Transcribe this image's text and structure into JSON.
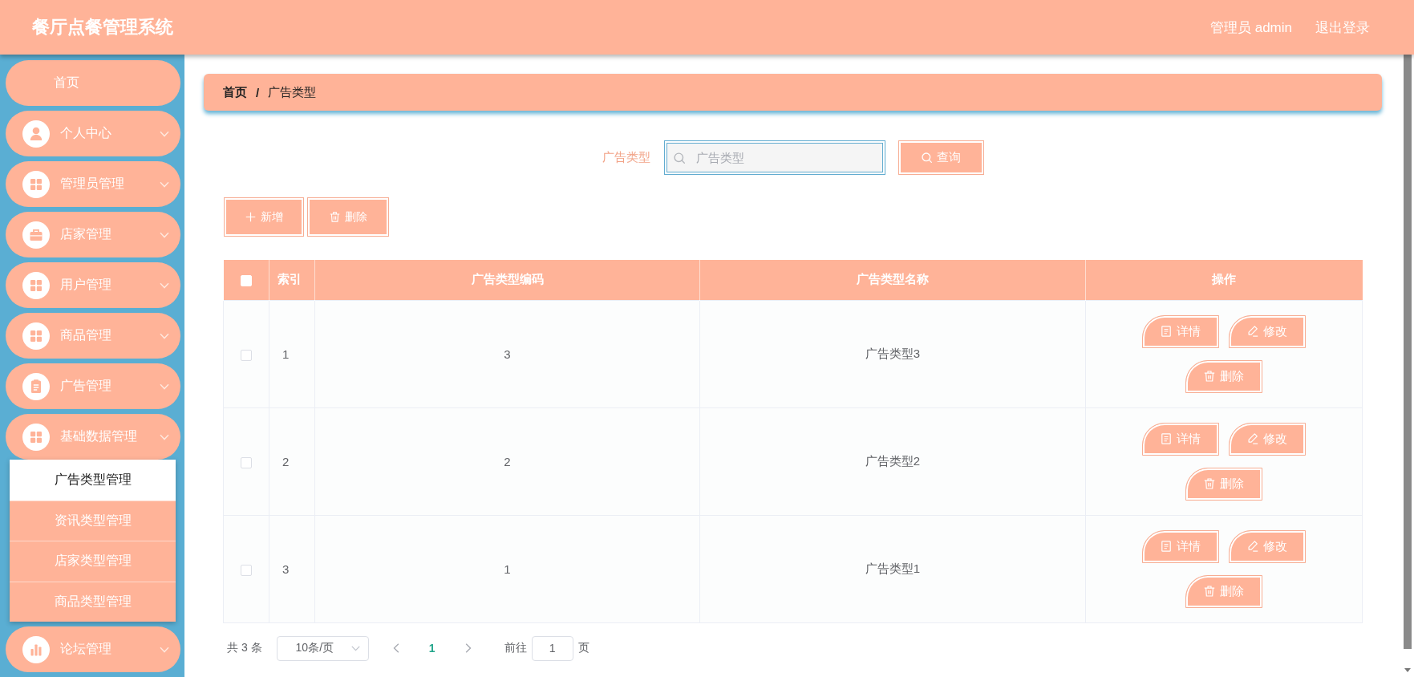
{
  "header": {
    "title": "餐厅点餐管理系统",
    "user": "管理员 admin",
    "logout": "退出登录"
  },
  "sidebar": {
    "items": [
      {
        "label": "首页",
        "kind": "plain"
      },
      {
        "label": "个人中心",
        "kind": "person"
      },
      {
        "label": "管理员管理",
        "kind": "grid"
      },
      {
        "label": "店家管理",
        "kind": "case"
      },
      {
        "label": "用户管理",
        "kind": "grid"
      },
      {
        "label": "商品管理",
        "kind": "grid"
      },
      {
        "label": "广告管理",
        "kind": "clipboard"
      },
      {
        "label": "基础数据管理",
        "kind": "grid",
        "children": [
          {
            "label": "广告类型管理",
            "selected": true
          },
          {
            "label": "资讯类型管理",
            "selected": false
          },
          {
            "label": "店家类型管理",
            "selected": false
          },
          {
            "label": "商品类型管理",
            "selected": false
          }
        ]
      },
      {
        "label": "论坛管理",
        "kind": "chart"
      }
    ]
  },
  "breadcrumb": {
    "items": [
      "首页",
      "广告类型"
    ],
    "separator": "/"
  },
  "search": {
    "label": "广告类型",
    "placeholder": "广告类型",
    "button": "查询"
  },
  "toolbar": [
    {
      "label": "新增",
      "kind": "add"
    },
    {
      "label": "删除",
      "kind": "delete"
    }
  ],
  "table": {
    "select_all": {
      "checked": false
    },
    "columns": [
      "索引",
      "广告类型编码",
      "广告类型名称",
      "操作"
    ],
    "rows": [
      {
        "checked": false,
        "cells": [
          "1",
          "3",
          "广告类型3"
        ],
        "actions": [
          {
            "label": "详情",
            "kind": "detail"
          },
          {
            "label": "修改",
            "kind": "edit"
          },
          {
            "label": "删除",
            "kind": "delete"
          }
        ]
      },
      {
        "checked": false,
        "cells": [
          "2",
          "2",
          "广告类型2"
        ],
        "actions": [
          {
            "label": "详情",
            "kind": "detail"
          },
          {
            "label": "修改",
            "kind": "edit"
          },
          {
            "label": "删除",
            "kind": "delete"
          }
        ]
      },
      {
        "checked": false,
        "cells": [
          "3",
          "1",
          "广告类型1"
        ],
        "actions": [
          {
            "label": "详情",
            "kind": "detail"
          },
          {
            "label": "修改",
            "kind": "edit"
          },
          {
            "label": "删除",
            "kind": "delete"
          }
        ]
      }
    ]
  },
  "pagination": {
    "total": "共 3 条",
    "page_size": "10条/页",
    "pages": [
      {
        "label": "1",
        "selected": true
      }
    ],
    "goto_label": "前往",
    "goto_value": "1",
    "goto_unit": "页"
  }
}
